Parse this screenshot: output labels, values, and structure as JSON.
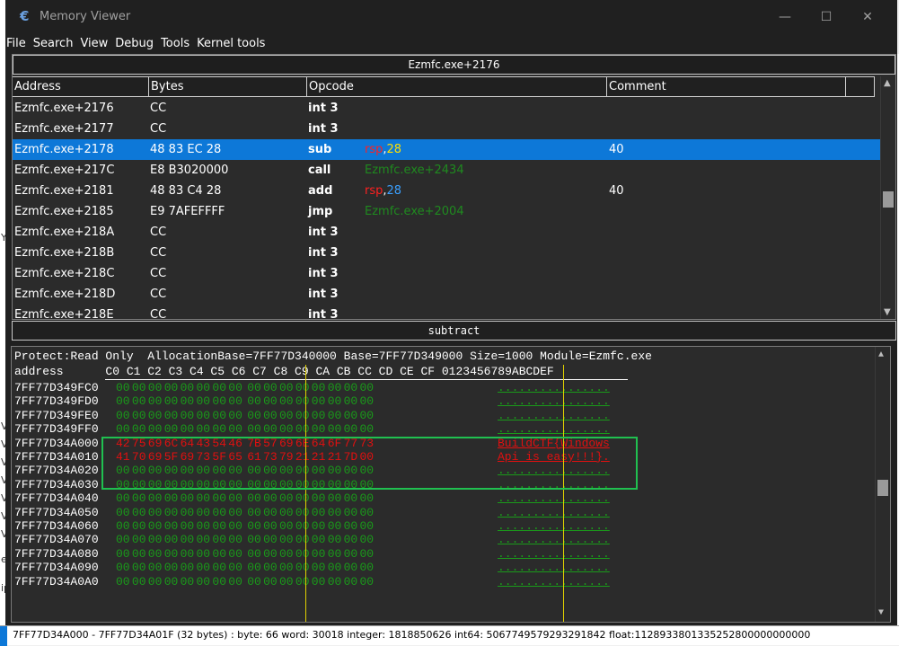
{
  "window": {
    "title": "Memory Viewer"
  },
  "menu": [
    "File",
    "Search",
    "View",
    "Debug",
    "Tools",
    "Kernel tools"
  ],
  "disasm": {
    "address_header": "Ezmfc.exe+2176",
    "columns": [
      "Address",
      "Bytes",
      "Opcode",
      "Comment"
    ],
    "rows": [
      {
        "addr": "Ezmfc.exe+2176",
        "bytes": "CC",
        "op": "int 3",
        "arg": "",
        "cmt": ""
      },
      {
        "addr": "Ezmfc.exe+2177",
        "bytes": "CC",
        "op": "int 3",
        "arg": "",
        "cmt": ""
      },
      {
        "addr": "Ezmfc.exe+2178",
        "bytes": "48 83 EC 28",
        "op": "sub",
        "arg_reg": "rsp",
        "arg_num": "28",
        "cmt": "40"
      },
      {
        "addr": "Ezmfc.exe+217C",
        "bytes": "E8 B3020000",
        "op": "call",
        "arg": "Ezmfc.exe+2434",
        "cmt": ""
      },
      {
        "addr": "Ezmfc.exe+2181",
        "bytes": "48 83 C4 28",
        "op": "add",
        "arg_reg": "rsp",
        "arg_num": "28",
        "cmt": "40"
      },
      {
        "addr": "Ezmfc.exe+2185",
        "bytes": "E9 7AFEFFFF",
        "op": "jmp",
        "arg": "Ezmfc.exe+2004",
        "cmt": ""
      },
      {
        "addr": "Ezmfc.exe+218A",
        "bytes": "CC",
        "op": "int 3",
        "arg": "",
        "cmt": ""
      },
      {
        "addr": "Ezmfc.exe+218B",
        "bytes": "CC",
        "op": "int 3",
        "arg": "",
        "cmt": ""
      },
      {
        "addr": "Ezmfc.exe+218C",
        "bytes": "CC",
        "op": "int 3",
        "arg": "",
        "cmt": ""
      },
      {
        "addr": "Ezmfc.exe+218D",
        "bytes": "CC",
        "op": "int 3",
        "arg": "",
        "cmt": ""
      },
      {
        "addr": "Ezmfc.exe+218E",
        "bytes": "CC",
        "op": "int 3",
        "arg": "",
        "cmt": ""
      }
    ]
  },
  "instruction_desc": "subtract",
  "hex": {
    "info": "Protect:Read Only  AllocationBase=7FF77D340000 Base=7FF77D349000 Size=1000 Module=Ezmfc.exe",
    "header": "address      C0 C1 C2 C3 C4 C5 C6 C7 C8 C9 CA CB CC CD CE CF 0123456789ABCDEF",
    "rows": [
      {
        "addr": "7FF77D349FC0",
        "bytes": "00 00 00 00 00 00 00 00 00 00 00 00 00 00 00 00",
        "text": "................",
        "hi": false
      },
      {
        "addr": "7FF77D349FD0",
        "bytes": "00 00 00 00 00 00 00 00 00 00 00 00 00 00 00 00",
        "text": "................",
        "hi": false
      },
      {
        "addr": "7FF77D349FE0",
        "bytes": "00 00 00 00 00 00 00 00 00 00 00 00 00 00 00 00",
        "text": "................",
        "hi": false
      },
      {
        "addr": "7FF77D349FF0",
        "bytes": "00 00 00 00 00 00 00 00 00 00 00 00 00 00 00 00",
        "text": "................",
        "hi": false
      },
      {
        "addr": "7FF77D34A000",
        "bytes": "42 75 69 6C 64 43 54 46 7B 57 69 6E 64 6F 77 73",
        "text": "BuildCTF{Windows",
        "hi": true
      },
      {
        "addr": "7FF77D34A010",
        "bytes": "41 70 69 5F 69 73 5F 65 61 73 79 21 21 21 7D 00",
        "text": "Api_is_easy!!!}.",
        "hi": true
      },
      {
        "addr": "7FF77D34A020",
        "bytes": "00 00 00 00 00 00 00 00 00 00 00 00 00 00 00 00",
        "text": "................",
        "hi": false
      },
      {
        "addr": "7FF77D34A030",
        "bytes": "00 00 00 00 00 00 00 00 00 00 00 00 00 00 00 00",
        "text": "................",
        "hi": false
      },
      {
        "addr": "7FF77D34A040",
        "bytes": "00 00 00 00 00 00 00 00 00 00 00 00 00 00 00 00",
        "text": "................",
        "hi": false
      },
      {
        "addr": "7FF77D34A050",
        "bytes": "00 00 00 00 00 00 00 00 00 00 00 00 00 00 00 00",
        "text": "................",
        "hi": false
      },
      {
        "addr": "7FF77D34A060",
        "bytes": "00 00 00 00 00 00 00 00 00 00 00 00 00 00 00 00",
        "text": "................",
        "hi": false
      },
      {
        "addr": "7FF77D34A070",
        "bytes": "00 00 00 00 00 00 00 00 00 00 00 00 00 00 00 00",
        "text": "................",
        "hi": false
      },
      {
        "addr": "7FF77D34A080",
        "bytes": "00 00 00 00 00 00 00 00 00 00 00 00 00 00 00 00",
        "text": "................",
        "hi": false
      },
      {
        "addr": "7FF77D34A090",
        "bytes": "00 00 00 00 00 00 00 00 00 00 00 00 00 00 00 00",
        "text": "................",
        "hi": false
      },
      {
        "addr": "7FF77D34A0A0",
        "bytes": "00 00 00 00 00 00 00 00 00 00 00 00 00 00 00 00",
        "text": "................",
        "hi": false
      }
    ]
  },
  "status": "7FF77D34A000 - 7FF77D34A01F (32 bytes) : byte: 66 word: 30018 integer: 1818850626 int64: 5067749579293291842 float:1128933801335252800000000000",
  "colors": {
    "selection": "#0d78d8",
    "register": "#ff2020",
    "label": "#1f8a1f",
    "hex_zero": "#1a9a1a",
    "hex_highlight": "#e01010",
    "annotation_box": "#20c050"
  }
}
